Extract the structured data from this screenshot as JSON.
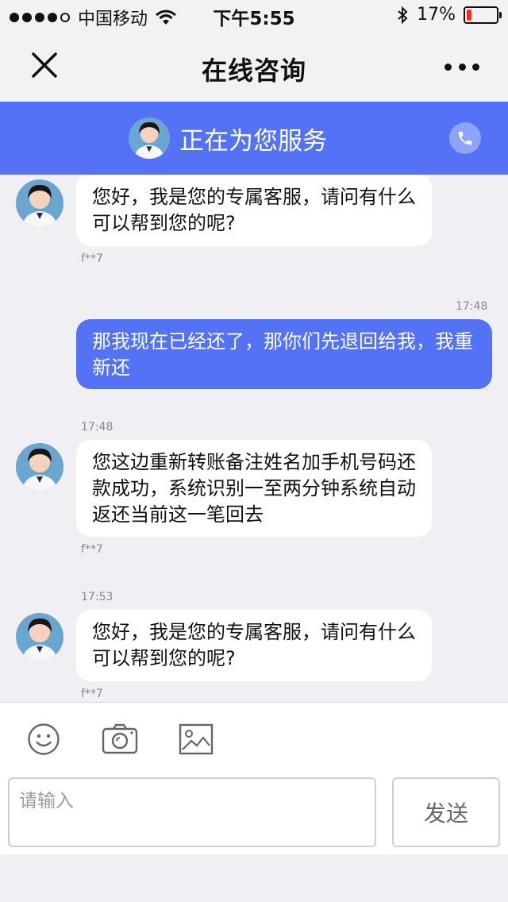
{
  "status_bar": {
    "carrier": "中国移动",
    "time": "下午5:55",
    "battery_pct": "17%",
    "battery_level": 0.17,
    "battery_color": "#ff2a1e"
  },
  "nav": {
    "title": "在线咨询",
    "close_icon": "close-icon",
    "more_icon": "more-icon"
  },
  "banner": {
    "text": "正在为您服务",
    "color": "#5472f5",
    "call_icon": "phone-icon"
  },
  "messages": [
    {
      "dir": "in",
      "text": "您好，我是您的专属客服，请问有什么可以帮到您的呢?",
      "sender": "f**7"
    },
    {
      "dir": "out",
      "time": "17:48",
      "text": "那我现在已经还了，那你们先退回给我，我重新还"
    },
    {
      "dir": "in",
      "time": "17:48",
      "text": "您这边重新转账备注姓名加手机号码还款成功，系统识别一至两分钟系统自动返还当前这一笔回去",
      "sender": "f**7"
    },
    {
      "dir": "in",
      "time": "17:53",
      "text": "您好，我是您的专属客服，请问有什么可以帮到您的呢?",
      "sender": "f**7"
    }
  ],
  "toolbar": {
    "icons": [
      "emoji-icon",
      "camera-icon",
      "image-icon"
    ],
    "input_placeholder": "请输入",
    "send_label": "发送"
  }
}
